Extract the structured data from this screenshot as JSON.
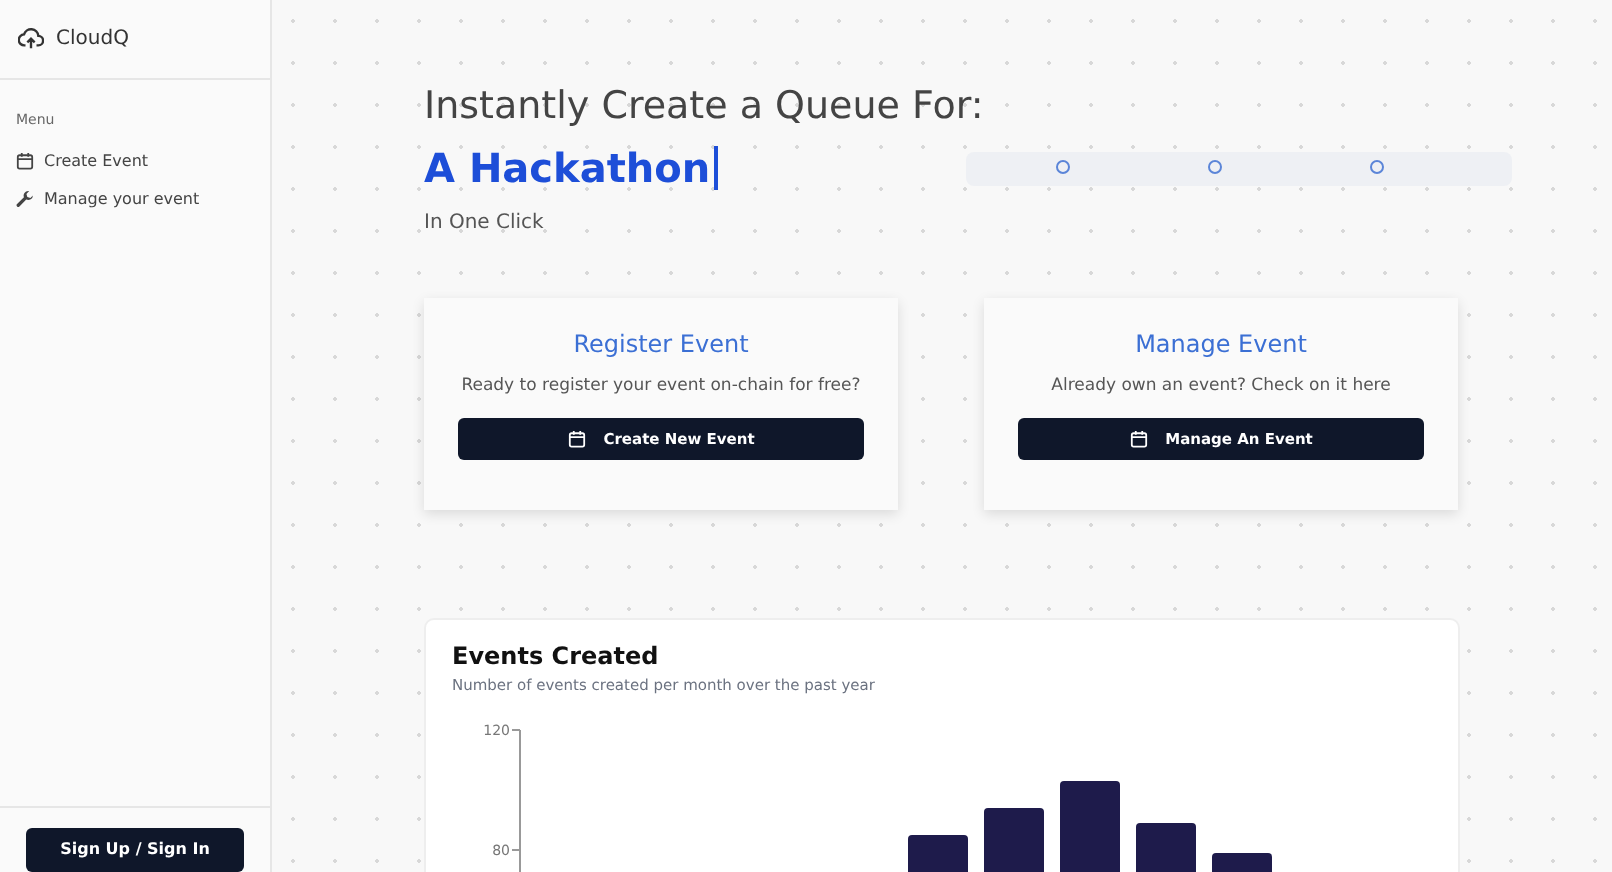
{
  "sidebar": {
    "logo": "CloudQ",
    "menu_heading": "Menu",
    "items": [
      {
        "kind": "calendar",
        "label": "Create Event"
      },
      {
        "kind": "tool",
        "label": "Manage your event"
      }
    ],
    "auth_button": "Sign Up / Sign In"
  },
  "hero": {
    "heading": "Instantly Create a Queue For:",
    "typed": "A Hackathon",
    "subtitle": "In One Click"
  },
  "cards": [
    {
      "title": "Register Event",
      "text": "Ready to register your event on-chain for free?",
      "button": "Create New Event"
    },
    {
      "title": "Manage Event",
      "text": "Already own an event? Check on it here",
      "button": "Manage An Event"
    }
  ],
  "chart": {
    "title": "Events Created",
    "subtitle": "Number of events created per month over the past year",
    "y_axis_labels": [
      "120",
      "80"
    ]
  }
}
